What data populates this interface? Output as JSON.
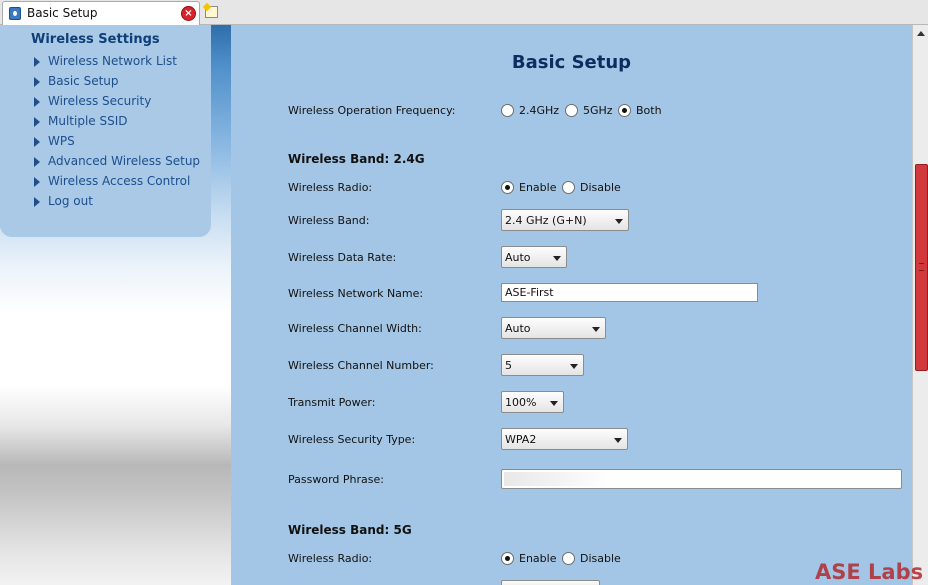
{
  "tab": {
    "title": "Basic Setup",
    "icon": "router-page-icon",
    "close_icon": "close-icon",
    "new_tab_icon": "new-tab-icon"
  },
  "sidebar": {
    "title": "Wireless Settings",
    "items": [
      {
        "label": "Wireless Network List"
      },
      {
        "label": "Basic Setup"
      },
      {
        "label": "Wireless Security"
      },
      {
        "label": "Multiple SSID"
      },
      {
        "label": "WPS"
      },
      {
        "label": "Advanced Wireless Setup"
      },
      {
        "label": "Wireless Access Control"
      },
      {
        "label": "Log out"
      }
    ]
  },
  "main": {
    "title": "Basic Setup",
    "frequency": {
      "label": "Wireless Operation Frequency:",
      "options": [
        "2.4GHz",
        "5GHz",
        "Both"
      ],
      "selected": "Both"
    },
    "band24": {
      "heading": "Wireless Band: 2.4G",
      "radio_label": "Wireless Radio:",
      "radio_enable": "Enable",
      "radio_disable": "Disable",
      "radio_selected": "Enable",
      "band_label": "Wireless Band:",
      "band_value": "2.4 GHz (G+N)",
      "rate_label": "Wireless Data Rate:",
      "rate_value": "Auto",
      "name_label": "Wireless Network Name:",
      "name_value": "ASE-First",
      "width_label": "Wireless Channel Width:",
      "width_value": "Auto",
      "channel_label": "Wireless Channel Number:",
      "channel_value": "5",
      "power_label": "Transmit Power:",
      "power_value": "100%",
      "security_label": "Wireless Security Type:",
      "security_value": "WPA2",
      "password_label": "Password Phrase:",
      "password_value": ""
    },
    "band5": {
      "heading": "Wireless Band: 5G",
      "radio_label": "Wireless Radio:",
      "radio_enable": "Enable",
      "radio_disable": "Disable",
      "radio_selected": "Enable"
    }
  },
  "watermark": "ASE Labs",
  "colors": {
    "content_bg": "#a4c6e6",
    "menu_bg": "#a9c9e6",
    "menu_text": "#1d4f8d",
    "title_text": "#0d2d5e",
    "scroll_thumb": "#d1393c",
    "watermark": "#b22a2f"
  }
}
